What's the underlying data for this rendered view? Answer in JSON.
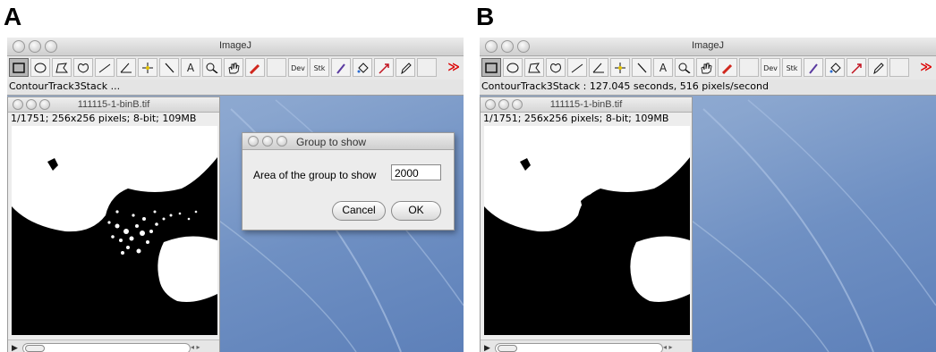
{
  "panels": [
    {
      "letter": "A",
      "app_title": "ImageJ",
      "status": "ContourTrack3Stack ...",
      "image_window": {
        "title": "111115-1-binB.tif",
        "info": "1/1751; 256x256 pixels; 8-bit; 109MB"
      },
      "dialog": {
        "title": "Group to show",
        "label": "Area of the group to show",
        "value": "2000",
        "cancel": "Cancel",
        "ok": "OK"
      }
    },
    {
      "letter": "B",
      "app_title": "ImageJ",
      "status": "ContourTrack3Stack : 127.045 seconds, 516 pixels/second",
      "image_window": {
        "title": "111115-1-binB.tif",
        "info": "1/1751; 256x256 pixels; 8-bit; 109MB"
      }
    }
  ],
  "toolbar": {
    "text_tool": "A",
    "dev_label": "Dev",
    "stk_label": "Stk",
    "more": "≫"
  },
  "colors": {
    "desktop": "#7f9ccb",
    "dropper": "#d0271d",
    "chevron": "#dd0000"
  }
}
